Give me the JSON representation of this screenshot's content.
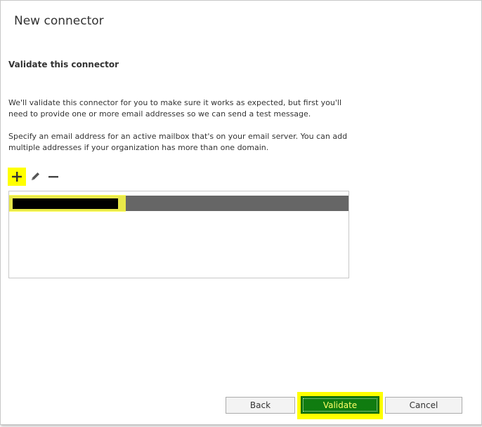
{
  "dialog": {
    "title": "New connector",
    "section_heading": "Validate this connector",
    "paragraph1": "We'll validate this connector for you to make sure it works as expected, but first you'll need to provide one or more email addresses so we can send a test message.",
    "paragraph2": "Specify an email address for an active mailbox that's on your email server. You can add multiple addresses if your organization has more than one domain."
  },
  "toolbar": {
    "add_icon": "plus-icon",
    "edit_icon": "pencil-icon",
    "remove_icon": "minus-icon"
  },
  "email_list": {
    "items": [
      {
        "value": ""
      }
    ]
  },
  "buttons": {
    "back": "Back",
    "validate": "Validate",
    "cancel": "Cancel"
  },
  "colors": {
    "highlight": "#ffff00",
    "primary_button": "#107c10",
    "selected_row": "#666666"
  }
}
